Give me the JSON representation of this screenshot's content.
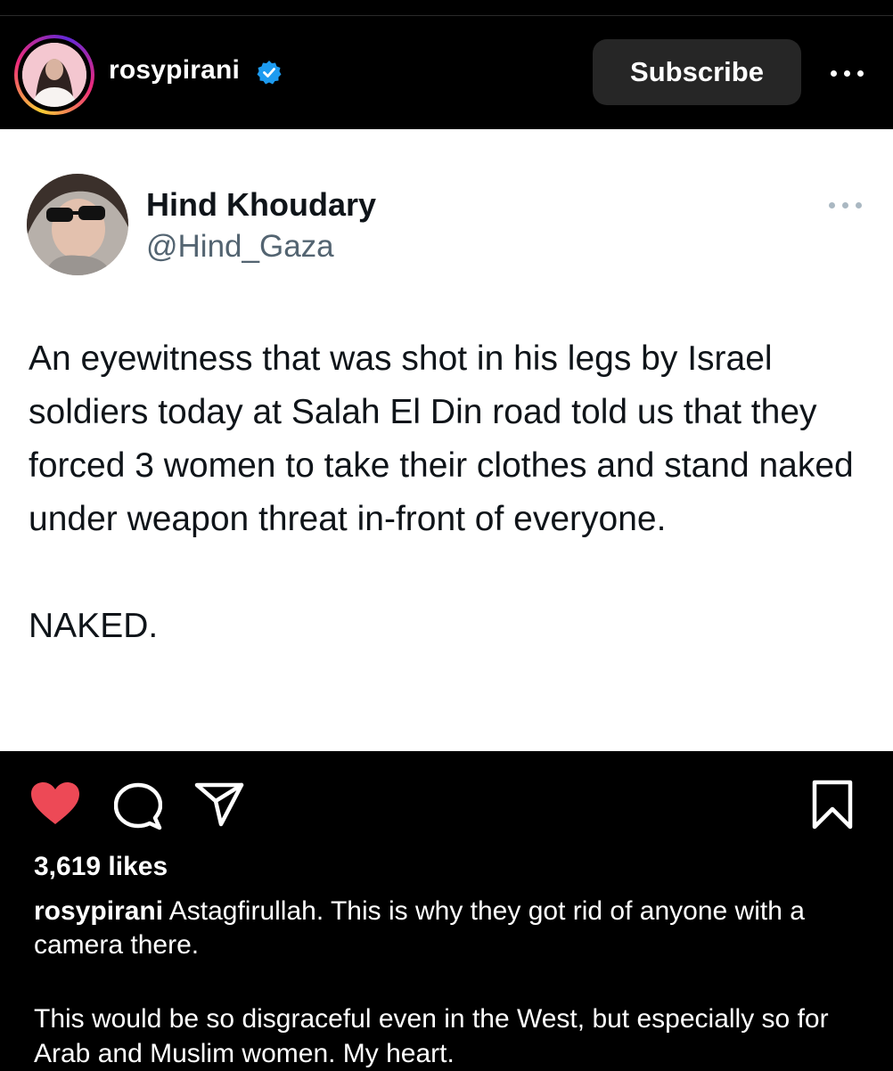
{
  "post": {
    "username": "rosypirani",
    "subscribe_label": "Subscribe"
  },
  "tweet": {
    "name": "Hind Khoudary",
    "handle": "@Hind_Gaza",
    "body": "An eyewitness that was shot in his legs by Israel soldiers today at Salah El Din road told us that they forced 3 women to take their clothes and stand naked under weapon threat in-front of everyone.\n\nNAKED."
  },
  "engagement": {
    "likes": "3,619 likes"
  },
  "caption": {
    "user": "rosypirani",
    "text": "Astagfirullah. This is why they got rid of anyone with a camera there.",
    "text2": "This would be so disgraceful even in the West, but especially so for Arab and Muslim women. My heart."
  },
  "icons": {
    "verified": "verified-badge-icon",
    "more": "more-options-icon",
    "like": "heart-icon",
    "comment": "comment-icon",
    "share": "share-icon",
    "save": "bookmark-icon"
  },
  "colors": {
    "like": "#ed4956",
    "verified": "#1d9bf0",
    "subscribe_bg": "#262626"
  }
}
